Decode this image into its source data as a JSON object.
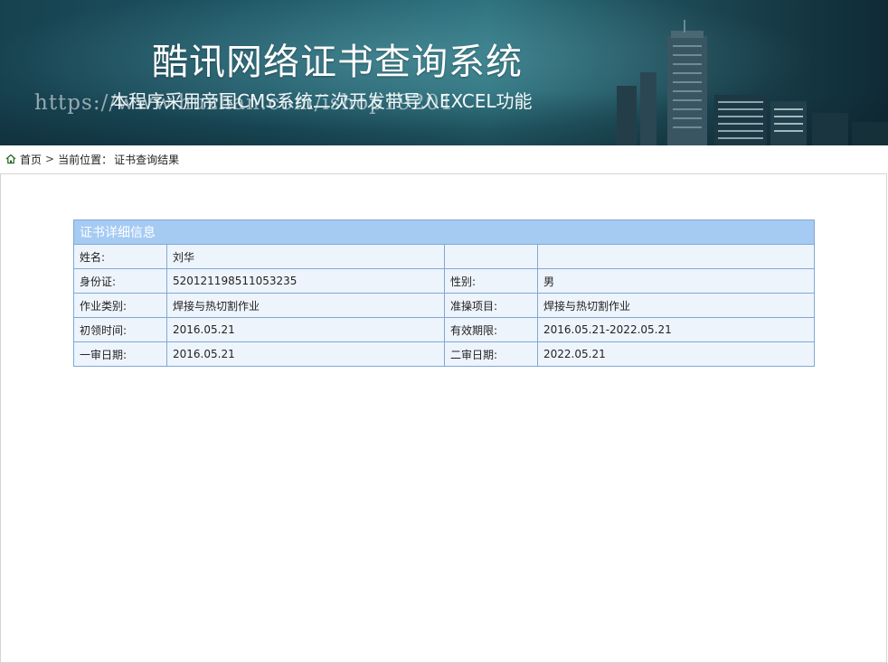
{
  "banner": {
    "title": "酷讯网络证书查询系统",
    "subtitle": "本程序采用帝国CMS系统二次开发带导入EXCEL功能",
    "watermark": "https://www.huzhan.com/ishop19201"
  },
  "breadcrumb": {
    "home": "首页",
    "separator": ">",
    "location_label": "当前位置：",
    "current": "证书查询结果"
  },
  "certificate": {
    "header": "证书详细信息",
    "rows": [
      {
        "label1": "姓名:",
        "value1": "刘华",
        "label2": "",
        "value2": ""
      },
      {
        "label1": "身份证:",
        "value1": "520121198511053235",
        "label2": "性别:",
        "value2": "男"
      },
      {
        "label1": "作业类别:",
        "value1": "焊接与热切割作业",
        "label2": "准操项目:",
        "value2": "焊接与热切割作业"
      },
      {
        "label1": "初领时间:",
        "value1": "2016.05.21",
        "label2": "有效期限:",
        "value2": "2016.05.21-2022.05.21"
      },
      {
        "label1": "一审日期:",
        "value1": "2016.05.21",
        "label2": "二审日期:",
        "value2": "2022.05.21"
      }
    ]
  },
  "colors": {
    "table_header": "#a6cbf3",
    "table_border": "#7fa9d6",
    "table_cell": "#eef4fc",
    "banner": "#1d5564"
  },
  "icons": {
    "home": "home-icon"
  }
}
